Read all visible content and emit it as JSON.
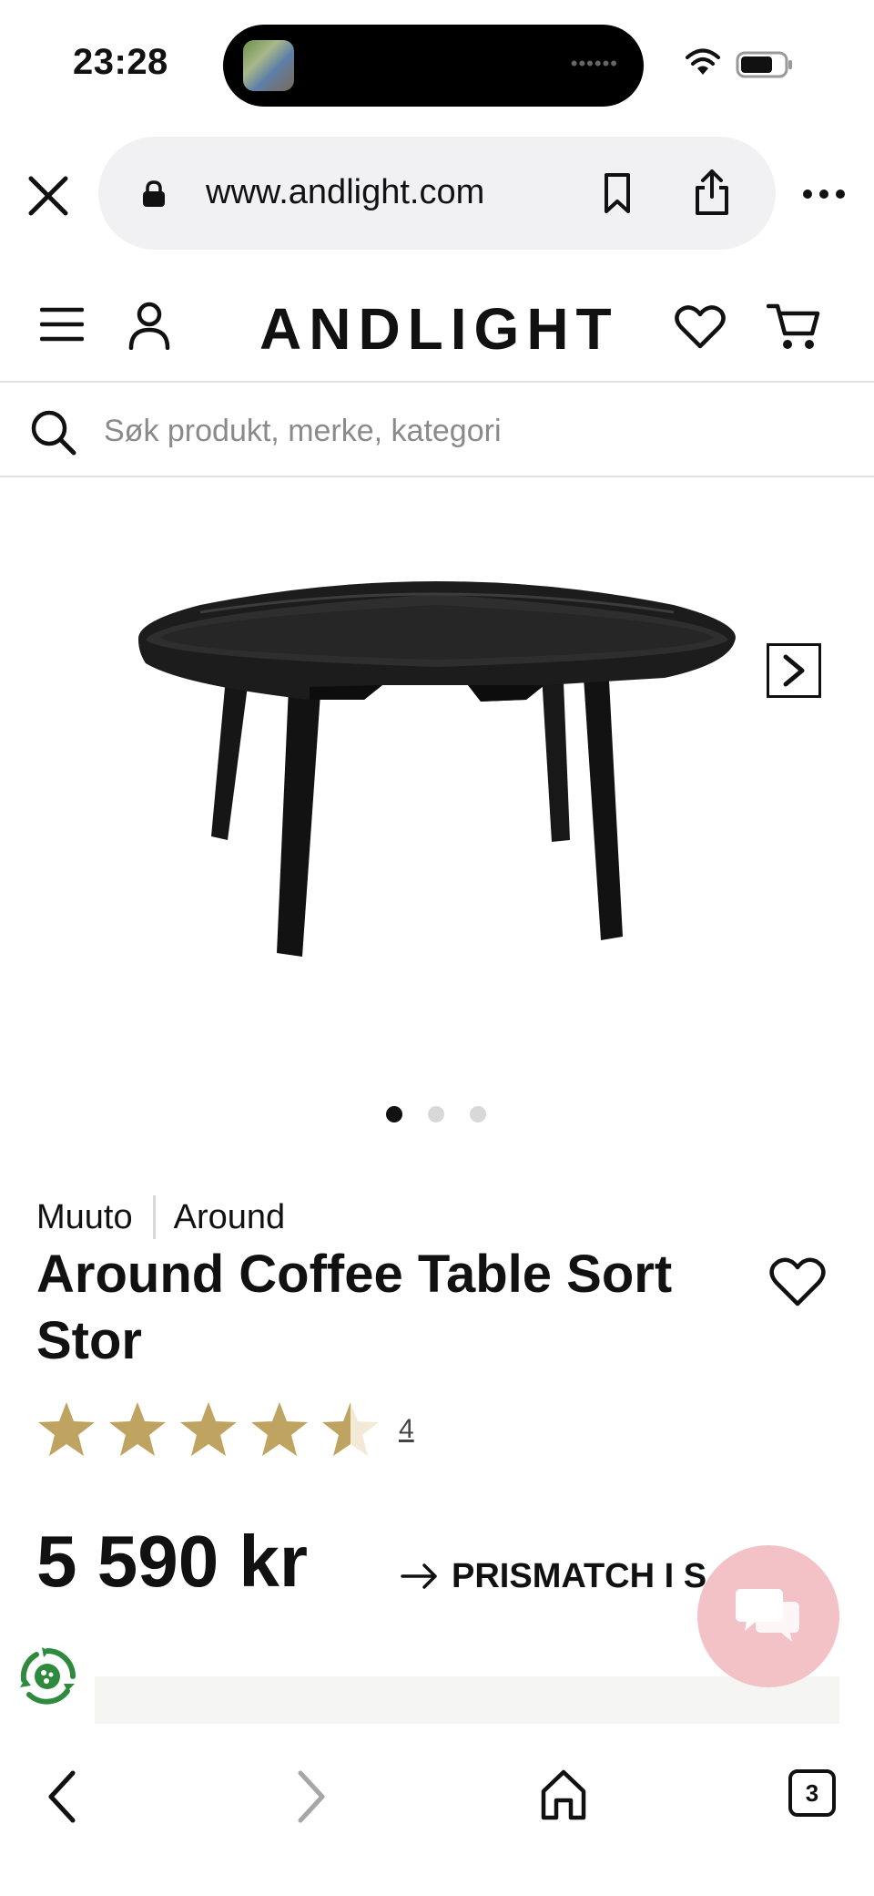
{
  "status_bar": {
    "time": "23:28",
    "island_indicator": "••••••"
  },
  "browser": {
    "url": "www.andlight.com"
  },
  "site": {
    "logo": "ANDLIGHT",
    "search_placeholder": "Søk produkt, merke, kategori"
  },
  "carousel": {
    "image_count": 3,
    "active_index": 0
  },
  "product": {
    "brand": "Muuto",
    "series": "Around",
    "title": "Around Coffee Table Sort Stor",
    "rating": 4.5,
    "rating_max": 5,
    "review_count": "4",
    "price": "5 590 kr",
    "price_match_label": "PRISMATCH I S"
  },
  "tabs_count": "3",
  "colors": {
    "star": "#bfa461",
    "star_empty": "#f2ead7",
    "chat": "#f2c2c6",
    "eco": "#2e8b3e"
  }
}
